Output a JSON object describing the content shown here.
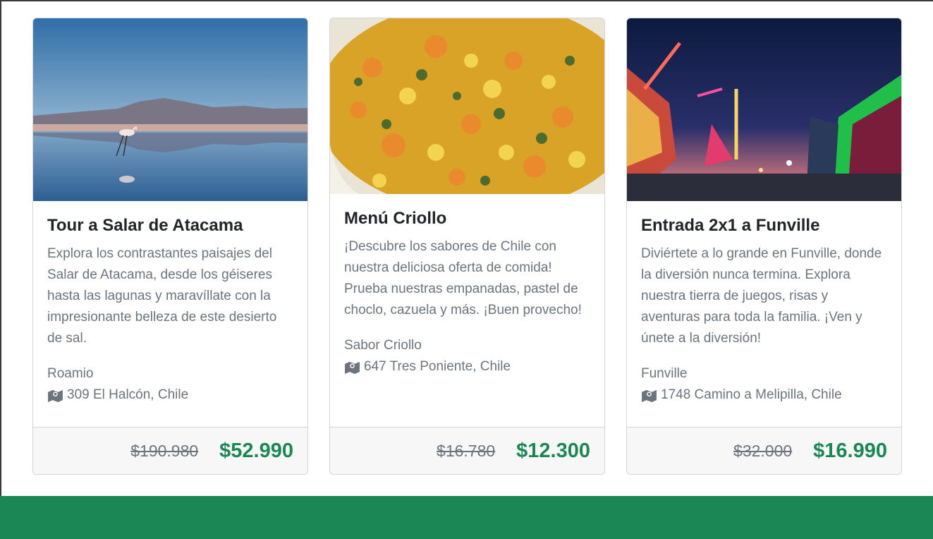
{
  "theme": {
    "accent": "#1b8754",
    "muted": "#6c757d",
    "footer_bg": "#f7f7f7"
  },
  "cards": [
    {
      "image_icon": "salt-flat-flamingo-photo",
      "title": "Tour a Salar de Atacama",
      "description": "Explora los contrastantes paisajes del Salar de Atacama, desde los géiseres hasta las lagunas y maravíllate con la impresionante belleza de este desierto de sal.",
      "provider": "Roamio",
      "address": "309 El Halcón, Chile",
      "address_icon": "map-icon",
      "old_price": "$190.980",
      "new_price": "$52.990"
    },
    {
      "image_icon": "chilean-food-photo",
      "title": "Menú Criollo",
      "description": "¡Descubre los sabores de Chile con nuestra deliciosa oferta de comida! Prueba nuestras empanadas, pastel de choclo, cazuela y más. ¡Buen provecho!",
      "provider": "Sabor Criollo",
      "address": "647 Tres Poniente, Chile",
      "address_icon": "map-icon",
      "old_price": "$16.780",
      "new_price": "$12.300"
    },
    {
      "image_icon": "amusement-park-night-photo",
      "title": "Entrada 2x1 a Funville",
      "description": "Diviértete a lo grande en Funville, donde la diversión nunca termina. Explora nuestra tierra de juegos, risas y aventuras para toda la familia. ¡Ven y únete a la diversión!",
      "provider": "Funville",
      "address": "1748 Camino a Melipilla, Chile",
      "address_icon": "map-icon",
      "old_price": "$32.000",
      "new_price": "$16.990"
    }
  ]
}
